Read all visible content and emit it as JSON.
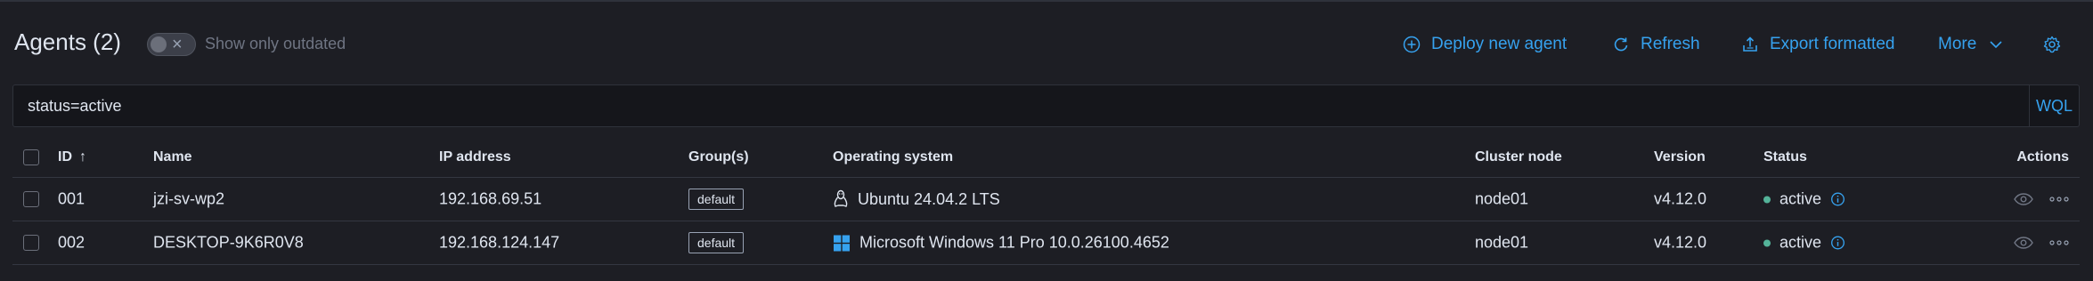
{
  "header": {
    "title": "Agents (2)",
    "toggle_label": "Show only outdated",
    "deploy_label": "Deploy new agent",
    "refresh_label": "Refresh",
    "export_label": "Export formatted",
    "more_label": "More"
  },
  "search": {
    "value": "status=active",
    "language_label": "WQL"
  },
  "table": {
    "columns": {
      "id": "ID",
      "name": "Name",
      "ip": "IP address",
      "groups": "Group(s)",
      "os": "Operating system",
      "cluster_node": "Cluster node",
      "version": "Version",
      "status": "Status",
      "actions": "Actions"
    },
    "rows": [
      {
        "id": "001",
        "name": "jzi-sv-wp2",
        "ip": "192.168.69.51",
        "group": "default",
        "os": "Ubuntu 24.04.2 LTS",
        "os_icon": "linux-icon",
        "cluster_node": "node01",
        "version": "v4.12.0",
        "status": "active"
      },
      {
        "id": "002",
        "name": "DESKTOP-9K6R0V8",
        "ip": "192.168.124.147",
        "group": "default",
        "os": "Microsoft Windows 11 Pro 10.0.26100.4652",
        "os_icon": "windows-icon",
        "cluster_node": "node01",
        "version": "v4.12.0",
        "status": "active"
      }
    ]
  },
  "colors": {
    "accent": "#36a2ef",
    "status_active": "#54b399",
    "background": "#1d1e24"
  }
}
